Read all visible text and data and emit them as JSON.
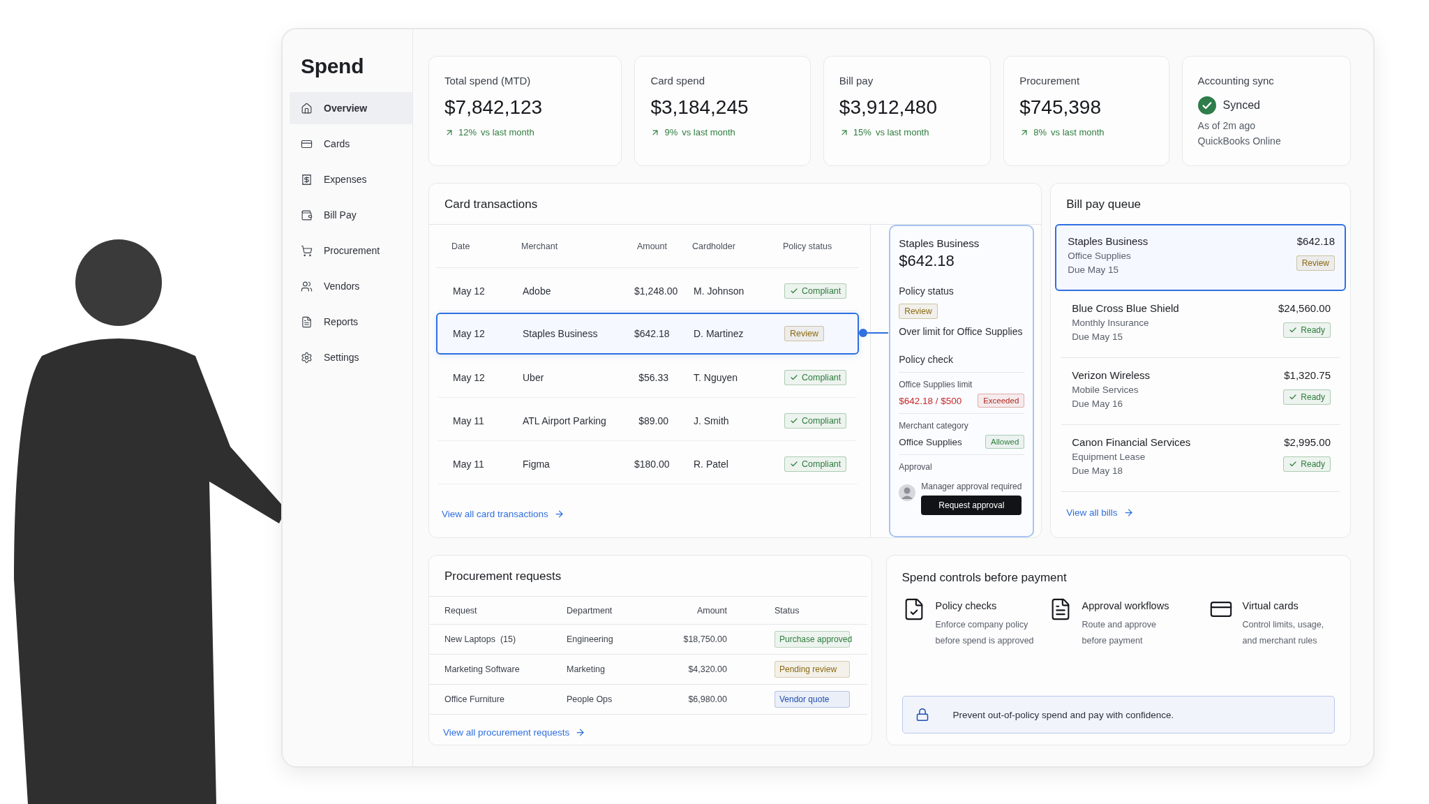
{
  "app": {
    "title": "Spend"
  },
  "sidebar": {
    "items": [
      {
        "label": "Overview",
        "selected": true
      },
      {
        "label": "Cards",
        "selected": false
      },
      {
        "label": "Expenses",
        "selected": false
      },
      {
        "label": "Bill Pay",
        "selected": false
      },
      {
        "label": "Procurement",
        "selected": false
      },
      {
        "label": "Vendors",
        "selected": false
      },
      {
        "label": "Reports",
        "selected": false
      },
      {
        "label": "Settings",
        "selected": false
      }
    ]
  },
  "stats": [
    {
      "kind": "metric",
      "label": "Total spend (MTD)",
      "value": "$7,842,123",
      "change": "12%",
      "change_text": "vs last month"
    },
    {
      "kind": "metric",
      "label": "Card spend",
      "value": "$3,184,245",
      "change": "9%",
      "change_text": "vs last month"
    },
    {
      "kind": "metric",
      "label": "Bill pay",
      "value": "$3,912,480",
      "change": "15%",
      "change_text": "vs last month"
    },
    {
      "kind": "metric",
      "label": "Procurement",
      "value": "$745,398",
      "change": "8%",
      "change_text": "vs last month"
    },
    {
      "kind": "sync",
      "label": "Accounting sync",
      "status": "Synced",
      "time": "As of 2m ago",
      "system": "QuickBooks Online"
    }
  ],
  "card_transactions": {
    "title": "Card transactions",
    "columns": [
      "Date",
      "Merchant",
      "Amount",
      "Cardholder",
      "Policy status"
    ],
    "rows": [
      {
        "date": "May 12",
        "merchant": "Adobe",
        "amount": "$1,248.00",
        "cardholder": "M. Johnson",
        "status": "Compliant",
        "color": "#2e7d3e",
        "selected": false
      },
      {
        "date": "May 12",
        "merchant": "Staples Business",
        "amount": "$642.18",
        "cardholder": "D. Martinez",
        "status": "Review",
        "color": "#8a6a12",
        "selected": true
      },
      {
        "date": "May 12",
        "merchant": "Uber",
        "amount": "$56.33",
        "cardholder": "T. Nguyen",
        "status": "Compliant",
        "color": "#2e7d3e",
        "selected": false
      },
      {
        "date": "May 11",
        "merchant": "ATL Airport Parking",
        "amount": "$89.00",
        "cardholder": "J. Smith",
        "status": "Compliant",
        "color": "#2e7d3e",
        "selected": false
      },
      {
        "date": "May 11",
        "merchant": "Figma",
        "amount": "$180.00",
        "cardholder": "R. Patel",
        "status": "Compliant",
        "color": "#2e7d3e",
        "selected": false
      }
    ],
    "link": "View all card transactions"
  },
  "detail": {
    "merchant": "Staples Business",
    "amount": "$642.18",
    "policy_status_label": "Policy status",
    "policy_status": {
      "text": "Review",
      "color": "#8a6a12"
    },
    "note": "Over limit for Office Supplies",
    "policy_check_label": "Policy check",
    "checks": [
      {
        "label": "Office Supplies limit",
        "value": "$642.18 / $500",
        "over_limit": true,
        "badge": {
          "text": "Exceeded",
          "color": "#b3261e"
        }
      },
      {
        "label": "Merchant category",
        "value": "Office Supplies",
        "over_limit": false,
        "badge": {
          "text": "Allowed",
          "color": "#2e7d3e"
        }
      }
    ],
    "approval_label": "Approval",
    "approval_text": "Manager approval required",
    "button": "Request approval"
  },
  "bill_pay": {
    "title": "Bill pay queue",
    "items": [
      {
        "name": "Staples Business",
        "category": "Office Supplies",
        "due": "Due May 15",
        "amount": "$642.18",
        "status": "Review",
        "color": "#8a6a12",
        "selected": true
      },
      {
        "name": "Blue Cross Blue Shield",
        "category": "Monthly Insurance",
        "due": "Due May 15",
        "amount": "$24,560.00",
        "status": "Ready",
        "color": "#2e7d3e",
        "selected": false
      },
      {
        "name": "Verizon Wireless",
        "category": "Mobile Services",
        "due": "Due May 16",
        "amount": "$1,320.75",
        "status": "Ready",
        "color": "#2e7d3e",
        "selected": false
      },
      {
        "name": "Canon Financial Services",
        "category": "Equipment Lease",
        "due": "Due May 18",
        "amount": "$2,995.00",
        "status": "Ready",
        "color": "#2e7d3e",
        "selected": false
      }
    ],
    "link": "View all bills"
  },
  "procurement": {
    "title": "Procurement requests",
    "columns": [
      "Request",
      "Department",
      "Amount",
      "Status"
    ],
    "rows": [
      {
        "request": "New Laptops  (15)",
        "department": "Engineering",
        "amount": "$18,750.00",
        "status": "Purchase approved",
        "color": "#2e7d3e"
      },
      {
        "request": "Marketing Software",
        "department": "Marketing",
        "amount": "$4,320.00",
        "status": "Pending review",
        "color": "#8a6a12"
      },
      {
        "request": "Office Furniture",
        "department": "People Ops",
        "amount": "$6,980.00",
        "status": "Vendor quote",
        "color": "#1f4fb0"
      }
    ],
    "link": "View all procurement requests"
  },
  "spend_controls": {
    "title": "Spend controls before payment",
    "features": [
      {
        "title": "Policy checks",
        "lines": [
          "Enforce company policy",
          "before spend is approved"
        ]
      },
      {
        "title": "Approval workflows",
        "lines": [
          "Route and approve",
          "before payment"
        ]
      },
      {
        "title": "Virtual cards",
        "lines": [
          "Control limits, usage,",
          "and merchant rules"
        ]
      }
    ],
    "banner": "Prevent out-of-policy spend and pay with confidence."
  }
}
